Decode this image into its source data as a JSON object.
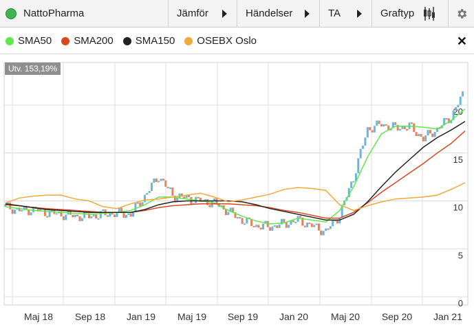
{
  "toolbar": {
    "title": "NattoPharma",
    "compare_label": "Jämför",
    "events_label": "Händelser",
    "ta_label": "TA",
    "graph_type_label": "Graftyp"
  },
  "legend": {
    "items": [
      {
        "label": "SMA50",
        "color": "#5ee84a"
      },
      {
        "label": "SMA200",
        "color": "#d9461f"
      },
      {
        "label": "SMA150",
        "color": "#222222"
      },
      {
        "label": "OSEBX Oslo",
        "color": "#f0a93a"
      }
    ]
  },
  "utv_label": "Utv. 153,19%",
  "chart_data": {
    "type": "line",
    "x_ticks": [
      "Maj 18",
      "Sep 18",
      "Jan 19",
      "Maj 19",
      "Sep 19",
      "Jan 20",
      "Maj 20",
      "Sep 20",
      "Jan 21"
    ],
    "y_ticks": [
      0,
      5,
      10,
      15,
      20
    ],
    "ylim": [
      0,
      25
    ],
    "price_color_up": "#6cb5d9",
    "price_color_down": "#e0825f",
    "series": [
      {
        "name": "SMA50",
        "color": "#5ee84a",
        "values": [
          9.4,
          9.2,
          9.0,
          8.9,
          8.8,
          8.7,
          8.6,
          8.7,
          8.8,
          9.0,
          9.6,
          10.4,
          10.4,
          10.2,
          10.0,
          9.8,
          9.0,
          8.4,
          7.9,
          7.6,
          7.7,
          8.2,
          8.0,
          7.8,
          9.0,
          11.5,
          14.6,
          17.0,
          17.8,
          17.8,
          17.7,
          17.5,
          18.4,
          19.6
        ]
      },
      {
        "name": "SMA200",
        "color": "#d9461f",
        "values": [
          9.6,
          9.5,
          9.3,
          9.2,
          9.1,
          9.0,
          8.9,
          8.8,
          8.8,
          8.8,
          9.0,
          9.3,
          9.5,
          9.6,
          9.7,
          9.7,
          9.7,
          9.6,
          9.5,
          9.3,
          9.0,
          8.8,
          8.5,
          8.2,
          8.2,
          8.8,
          9.8,
          10.9,
          11.9,
          12.9,
          13.9,
          15.0,
          16.0,
          17.3
        ]
      },
      {
        "name": "SMA150",
        "color": "#222222",
        "values": [
          9.7,
          9.5,
          9.3,
          9.1,
          9.0,
          8.9,
          8.8,
          8.8,
          8.8,
          8.8,
          9.1,
          9.6,
          9.9,
          10.0,
          10.0,
          10.0,
          10.0,
          9.9,
          9.6,
          9.2,
          8.9,
          8.6,
          8.3,
          8.0,
          8.0,
          8.6,
          9.9,
          11.5,
          13.0,
          14.3,
          15.6,
          16.6,
          17.4,
          18.3
        ]
      },
      {
        "name": "OSEBX Oslo",
        "color": "#f0a93a",
        "values": [
          9.8,
          10.3,
          10.5,
          10.6,
          10.6,
          10.2,
          10.0,
          9.4,
          9.2,
          9.7,
          10.1,
          10.2,
          10.4,
          10.6,
          10.8,
          10.4,
          9.9,
          10.1,
          10.4,
          10.7,
          11.2,
          11.4,
          11.3,
          11.1,
          9.6,
          9.0,
          9.5,
          9.9,
          10.2,
          10.3,
          10.4,
          10.6,
          11.2,
          11.9
        ]
      },
      {
        "name": "Price",
        "color": "#6cb5d9",
        "values": [
          9.4,
          9.0,
          9.1,
          8.8,
          8.6,
          8.4,
          8.4,
          8.6,
          8.7,
          8.6,
          10.5,
          12.6,
          10.6,
          10.3,
          10.0,
          9.8,
          8.9,
          8.0,
          7.4,
          7.3,
          7.6,
          8.0,
          7.4,
          6.8,
          8.5,
          12.5,
          17.5,
          18.0,
          17.6,
          17.8,
          16.5,
          17.5,
          18.8,
          21.5
        ]
      }
    ]
  }
}
